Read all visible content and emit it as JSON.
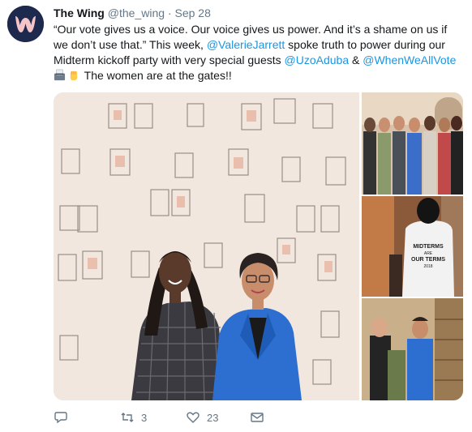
{
  "tweet": {
    "display_name": "The Wing",
    "handle": "@the_wing",
    "separator": "·",
    "date": "Sep 28",
    "text_1": "“Our vote gives us a voice. Our voice gives us power. And it’s a shame on us if we don’t use that.” This week, ",
    "mention_1": "@ValerieJarrett",
    "text_2": " spoke truth to power during our Midterm kickoff party with very special guests ",
    "mention_2": "@UzoAduba",
    "text_3": " & ",
    "mention_3": "@WhenWeAllVote",
    "text_4": " The women are at the gates!!",
    "emojis": [
      "ballot-box-icon",
      "raised-fist-icon"
    ]
  },
  "photos": {
    "shirt_text_line1": "MIDTERMS",
    "shirt_text_line2": "ARE",
    "shirt_text_line3": "OUR TERMS",
    "shirt_text_line4": "2018"
  },
  "actions": {
    "reply_icon": "reply-icon",
    "retweet_icon": "retweet-icon",
    "retweet_count": "3",
    "like_icon": "heart-icon",
    "like_count": "23",
    "dm_icon": "envelope-icon"
  },
  "colors": {
    "mention": "#1b95e0",
    "secondary_text": "#657786",
    "avatar_bg": "#1d2a4d",
    "avatar_letter": "#f4c4c8"
  }
}
